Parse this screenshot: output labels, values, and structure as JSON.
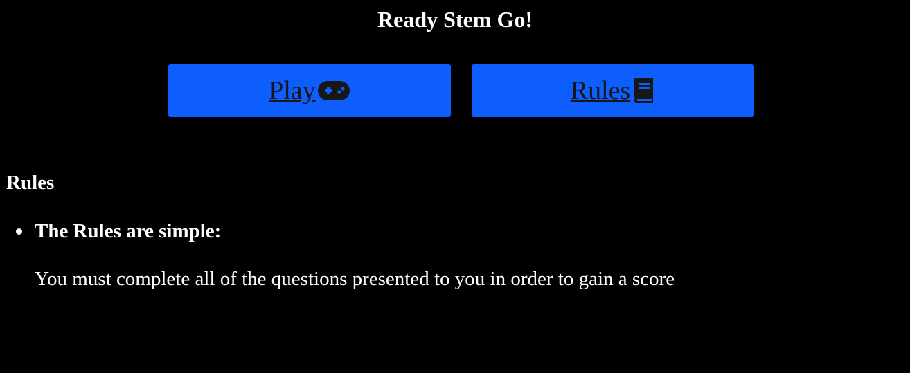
{
  "header": {
    "title": "Ready Stem Go!"
  },
  "buttons": {
    "play_label": "Play",
    "play_icon": "gamepad-icon",
    "rules_label": "Rules",
    "rules_icon": "book-icon",
    "background_color": "#0d5efc",
    "text_color": "#171717"
  },
  "rules": {
    "heading": "Rules",
    "items": [
      {
        "title": "The Rules are simple:",
        "text": "You must complete all of the questions presented to you in order to gain a score"
      }
    ]
  },
  "colors": {
    "page_background": "#000000",
    "page_text": "#ffffff"
  }
}
